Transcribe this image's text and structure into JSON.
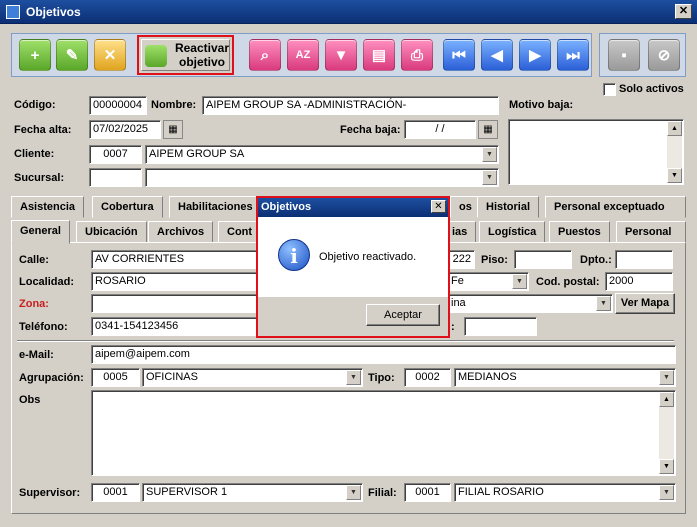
{
  "window": {
    "title": "Objetivos",
    "close": "✕"
  },
  "toolbar": {
    "reactivar_label": "Reactivar objetivo",
    "buttons": [
      "add-icon",
      "edit-icon",
      "delete-icon",
      "search-icon",
      "sort-az-icon",
      "filter-icon",
      "report-icon",
      "print-icon",
      "first-icon",
      "prev-icon",
      "next-icon",
      "last-icon"
    ],
    "sort_glyph": "AZ"
  },
  "solo_activos": "Solo activos",
  "form": {
    "codigo_label": "Código:",
    "codigo": "00000004",
    "nombre_label": "Nombre:",
    "nombre": "AIPEM GROUP SA -ADMINISTRACIÓN-",
    "motivo_baja_label": "Motivo baja:",
    "fecha_alta_label": "Fecha alta:",
    "fecha_alta": "07/02/2025",
    "fecha_baja_label": "Fecha baja:",
    "fecha_baja": "  /  /",
    "cliente_label": "Cliente:",
    "cliente_codigo": "0007",
    "cliente_nombre": "AIPEM GROUP SA",
    "sucursal_label": "Sucursal:"
  },
  "tabs_row1": [
    "Asistencia",
    "Cobertura",
    "Habilitaciones",
    "os",
    "Historial",
    "Personal exceptuado"
  ],
  "tabs_row2": [
    "General",
    "Ubicación",
    "Archivos",
    "Cont",
    "ias",
    "Logística",
    "Puestos",
    "Personal"
  ],
  "general": {
    "calle_label": "Calle:",
    "calle": "AV CORRIENTES",
    "numero_partial": "222",
    "piso_label": "Piso:",
    "dpto_label": "Dpto.:",
    "localidad_label": "Localidad:",
    "localidad": "ROSARIO",
    "provincia_partial": "Fe",
    "cod_postal_label": "Cod. postal:",
    "cod_postal": "2000",
    "zona_label": "Zona:",
    "zona_partial": "ina",
    "ver_mapa": "Ver Mapa",
    "telefono_label": "Teléfono:",
    "telefono": "0341-154123456",
    "telefono2_partial_label": ":",
    "email_label": "e-Mail:",
    "email": "aipem@aipem.com",
    "agrupacion_label": "Agrupación:",
    "agrupacion_codigo": "0005",
    "agrupacion": "OFICINAS",
    "tipo_label": "Tipo:",
    "tipo_codigo": "0002",
    "tipo": "MEDIANOS",
    "obs_label": "Obs",
    "supervisor_label": "Supervisor:",
    "supervisor_codigo": "0001",
    "supervisor": "SUPERVISOR 1",
    "filial_label": "Filial:",
    "filial_codigo": "0001",
    "filial": "FILIAL ROSARIO"
  },
  "dialog": {
    "title": "Objetivos",
    "message": "Objetivo reactivado.",
    "ok": "Aceptar",
    "close": "✕",
    "icon_glyph": "i"
  }
}
